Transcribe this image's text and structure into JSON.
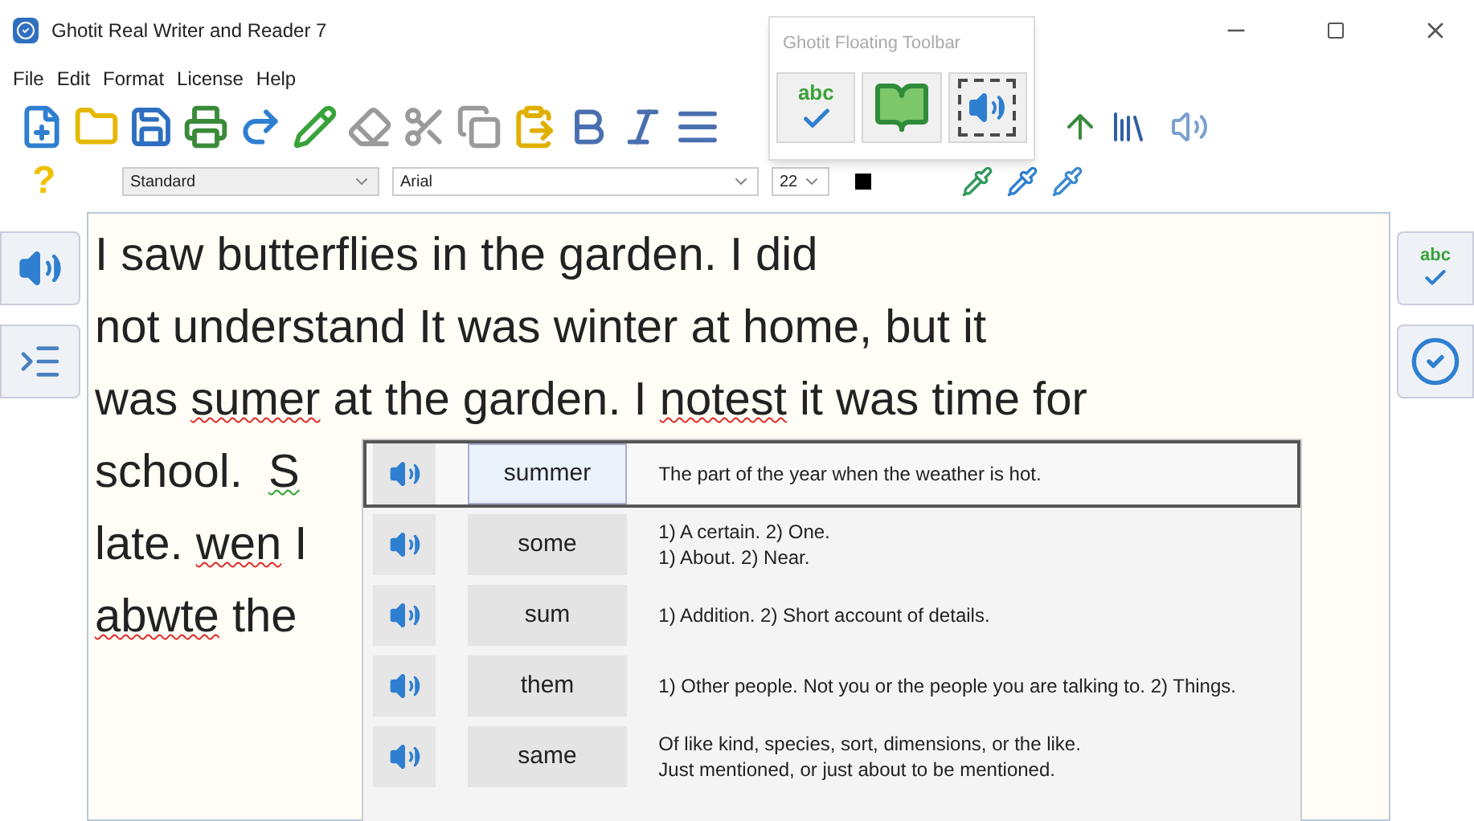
{
  "window": {
    "title": "Ghotit Real Writer and Reader 7"
  },
  "menu": [
    "File",
    "Edit",
    "Format",
    "License",
    "Help"
  ],
  "format_bar": {
    "help_glyph": "?",
    "style": "Standard",
    "font": "Arial",
    "size": "22"
  },
  "floating_toolbar": {
    "title": "Ghotit Floating Toolbar",
    "buttons": [
      {
        "kind": "spell",
        "label": "abc"
      },
      {
        "kind": "reader"
      },
      {
        "kind": "speak"
      }
    ]
  },
  "side_right": {
    "spell_label": "abc"
  },
  "document": {
    "lines": [
      [
        {
          "text": "I saw butterflies in the garden. I did",
          "kind": "plain"
        }
      ],
      [
        {
          "text": "not understand It was winter at home, but it",
          "kind": "plain"
        }
      ],
      [
        {
          "text": "was ",
          "kind": "plain"
        },
        {
          "text": "sumer",
          "kind": "misspelled"
        },
        {
          "text": " at the garden. I ",
          "kind": "plain"
        },
        {
          "text": "notest",
          "kind": "misspelled"
        },
        {
          "text": " it was time for",
          "kind": "plain"
        }
      ],
      [
        {
          "text": "school.  ",
          "kind": "plain"
        },
        {
          "text": "S",
          "kind": "grammar"
        }
      ],
      [
        {
          "text": "late. ",
          "kind": "plain"
        },
        {
          "text": "wen",
          "kind": "misspelled"
        },
        {
          "text": " I",
          "kind": "plain"
        }
      ],
      [
        {
          "text": "abwte",
          "kind": "misspelled"
        },
        {
          "text": " the",
          "kind": "plain"
        }
      ]
    ]
  },
  "suggestions": [
    {
      "word": "summer",
      "meaning": "The part of the year when the weather is hot.",
      "selected": true
    },
    {
      "word": "some",
      "meaning": "1) A certain. 2) One.\n1) About. 2) Near.",
      "selected": false
    },
    {
      "word": "sum",
      "meaning": "1) Addition. 2) Short account of details.",
      "selected": false
    },
    {
      "word": "them",
      "meaning": "1) Other people. Not you or the people you are talking to. 2) Things.",
      "selected": false
    },
    {
      "word": "same",
      "meaning": "Of like kind, species, sort, dimensions, or the like.\nJust mentioned, or just about to be mentioned.",
      "selected": false
    }
  ]
}
